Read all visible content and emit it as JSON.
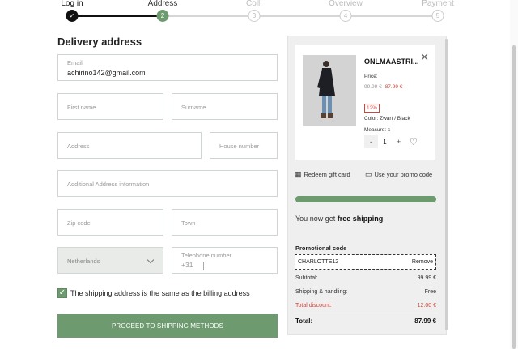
{
  "stepper": {
    "steps": [
      {
        "label": "Log in",
        "marker": "✓",
        "state": "done"
      },
      {
        "label": "Address",
        "marker": "2",
        "state": "active"
      },
      {
        "label": "Coll.",
        "marker": "3",
        "state": "todo"
      },
      {
        "label": "Overview",
        "marker": "4",
        "state": "todo"
      },
      {
        "label": "Payment",
        "marker": "5",
        "state": "todo"
      }
    ]
  },
  "form": {
    "title": "Delivery address",
    "email_label": "Email",
    "email_value": "achirino142@gmail.com",
    "first_name_placeholder": "First name",
    "surname_placeholder": "Surname",
    "address_placeholder": "Address",
    "house_number_placeholder": "House number",
    "additional_placeholder": "Additional Address information",
    "zip_placeholder": "Zip code",
    "town_placeholder": "Town",
    "country_value": "Netherlands",
    "phone_label": "Telephone number",
    "phone_prefix": "+31",
    "same_billing_label": "The shipping address is the same as the billing address",
    "same_billing_checked": true,
    "proceed_label": "PROCEED TO SHIPPING METHODS"
  },
  "summary": {
    "product": {
      "name": "ONLMAASTRI...",
      "price_label": "Price:",
      "old_price": "99.99 €",
      "new_price": "87.99 €",
      "discount_badge": "12%",
      "color_text": "Color: Zwart / Black",
      "measure_text": "Measure: s",
      "quantity": "1",
      "minus": "-",
      "plus": "+"
    },
    "redeem_gift_card": "Redeem gift card",
    "use_promo_code": "Use your promo code",
    "shipping_progress": 1.0,
    "shipping_prefix": "You now get",
    "shipping_strong": "free shipping",
    "promo_title": "Promotional code",
    "promo_code": "CHARLOTTE12",
    "promo_remove": "Remove",
    "subtotal_label": "Subtotal:",
    "subtotal_value": "99.99 €",
    "shipping_label": "Shipping & handling:",
    "shipping_value": "Free",
    "discount_label": "Total discount:",
    "discount_value": "12.00 €",
    "total_label": "Total:",
    "total_value": "87.99 €"
  },
  "colors": {
    "accent": "#6d9a6e",
    "discount": "#d0443a",
    "done": "#111111"
  }
}
